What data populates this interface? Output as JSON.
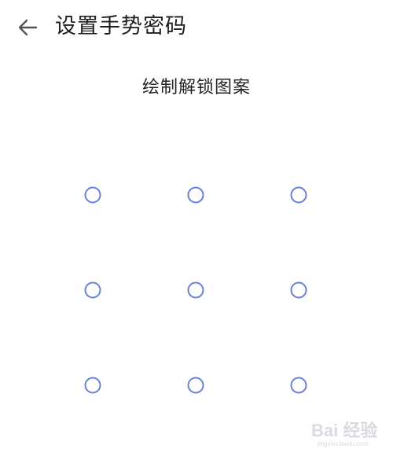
{
  "header": {
    "back_icon": "arrow-left-icon",
    "title": "设置手势密码"
  },
  "prompt": "绘制解锁图案",
  "pattern": {
    "rows": 3,
    "cols": 3,
    "dot_color": "#6a80d5",
    "dots": [
      "1",
      "2",
      "3",
      "4",
      "5",
      "6",
      "7",
      "8",
      "9"
    ]
  },
  "watermark": {
    "logo_text": "Bai 经验",
    "sub_text": "jingyan.baidu.com"
  }
}
